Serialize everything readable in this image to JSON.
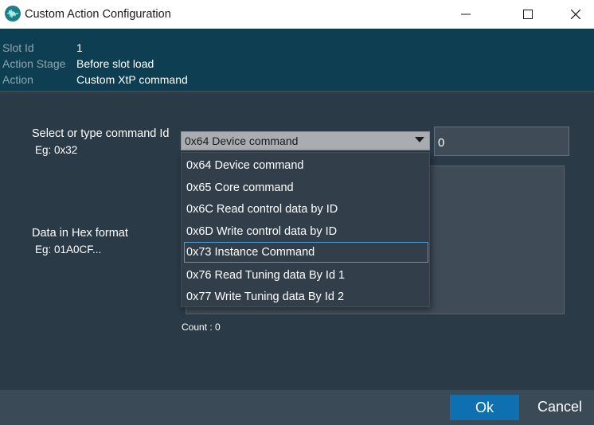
{
  "window": {
    "title": "Custom Action Configuration",
    "controls": [
      "minimize",
      "maximize",
      "close"
    ]
  },
  "info": {
    "slot_id_label": "Slot Id",
    "slot_id_value": "1",
    "stage_label": "Action Stage",
    "stage_value": "Before slot load",
    "action_label": "Action",
    "action_value": "Custom XtP command"
  },
  "form": {
    "command_label": "Select or type command Id",
    "command_example": "Eg: 0x32",
    "command_selected": "0x64 Device command",
    "command_id_value": "0",
    "hex_label": "Data in Hex format",
    "hex_example": "Eg: 01A0CF...",
    "count_text": "Count : 0"
  },
  "dropdown": {
    "options": [
      "0x64 Device command",
      "0x65 Core command",
      "0x6C Read control data by ID",
      "0x6D Write control data by ID",
      "0x73 Instance Command",
      "0x76 Read Tuning data By Id 1",
      "0x77 Write Tuning data By Id 2"
    ],
    "highlighted_index": 4
  },
  "buttons": {
    "ok": "Ok",
    "cancel": "Cancel"
  },
  "colors": {
    "accent": "#0e6fb1",
    "info_bar": "#0d3e52",
    "content_bg": "#2b3a47",
    "focus_border": "#4a9ad6"
  }
}
